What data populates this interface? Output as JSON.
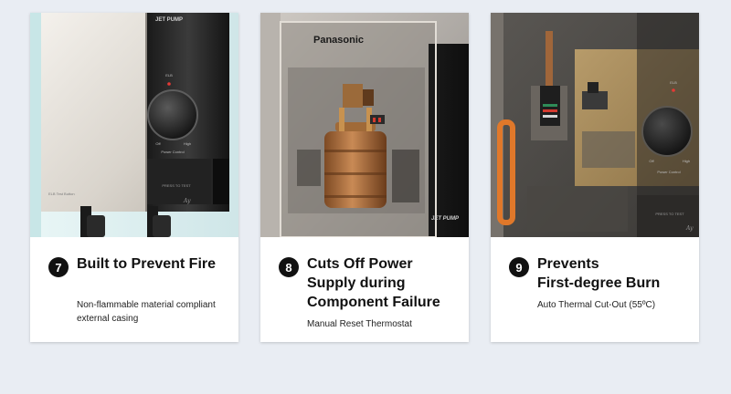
{
  "cards": [
    {
      "number": "7",
      "title": "Built to Prevent Fire",
      "description": "Non-flammable material compliant\nexternal casing",
      "image": {
        "panel_label": "JET PUMP",
        "indicator_label": "ELB",
        "dial_low": "Off",
        "dial_high": "High",
        "dial_caption": "Power Control",
        "slot_label": "PRESS TO TEST",
        "corner_label": "ELB Test Button",
        "logo_mark": "Ay"
      }
    },
    {
      "number": "8",
      "title": "Cuts Off Power\nSupply during\nComponent Failure",
      "description": "Manual Reset Thermostat",
      "image": {
        "brand": "Panasonic",
        "panel_label": "JET PUMP"
      }
    },
    {
      "number": "9",
      "title": "Prevents\nFirst-degree Burn",
      "description": "Auto Thermal Cut-Out (55ºC)",
      "image": {
        "indicator_label": "ELB",
        "dial_low": "Off",
        "dial_high": "High",
        "dial_caption": "Power Control",
        "slot_label": "PRESS TO TEST",
        "logo_mark": "Ay"
      }
    }
  ],
  "colors": {
    "page_background": "#e9edf3",
    "card_background": "#ffffff",
    "badge": "#111111",
    "indicator_red": "#e53935",
    "copper": "#b87333",
    "orange_pipe": "#e0782a"
  }
}
